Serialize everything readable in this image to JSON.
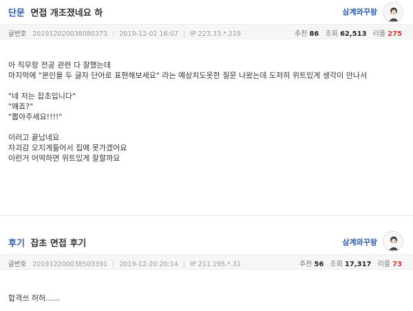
{
  "posts": [
    {
      "category": "단문",
      "title": "면접 개조졌네요 하",
      "author": "삼계와꾸왕",
      "serial_label": "글번호",
      "serial": "201912020038080373",
      "date": "2019-12-02 16:07",
      "ip": "IP 223.33.*.219",
      "rec_label": "추천",
      "rec": "86",
      "views_label": "조회",
      "views": "62,513",
      "comments_label": "리플",
      "comments": "275",
      "body": [
        "아 직무랑 전공 관련 다 잘했는데",
        "마지막에 \"본인을 두 글자 단어로 표현해보세요\" 라는 예상치도못한 질문 나왔는데 도저히 위트있게 생각이 안나서",
        "",
        "\"네 저는 잡초입니다\"",
        "\"왜죠?\"",
        "\"뽑아주세요!!!!\"",
        "",
        "이러고 끝났네요",
        "자괴감 오지게들어서 집에 못가겠어요",
        "이런거 어떡하면 위트있게 잘할까요"
      ]
    },
    {
      "category": "후기",
      "title": "잡초 면접 후기",
      "author": "삼계와꾸왕",
      "serial_label": "글번호",
      "serial": "201912200038503391",
      "date": "2019-12-20 20:14",
      "ip": "IP 211.195.*.31",
      "rec_label": "추천",
      "rec": "56",
      "views_label": "조회",
      "views": "17,317",
      "comments_label": "리플",
      "comments": "73",
      "body": [
        "합격쓰 허허......"
      ]
    }
  ]
}
